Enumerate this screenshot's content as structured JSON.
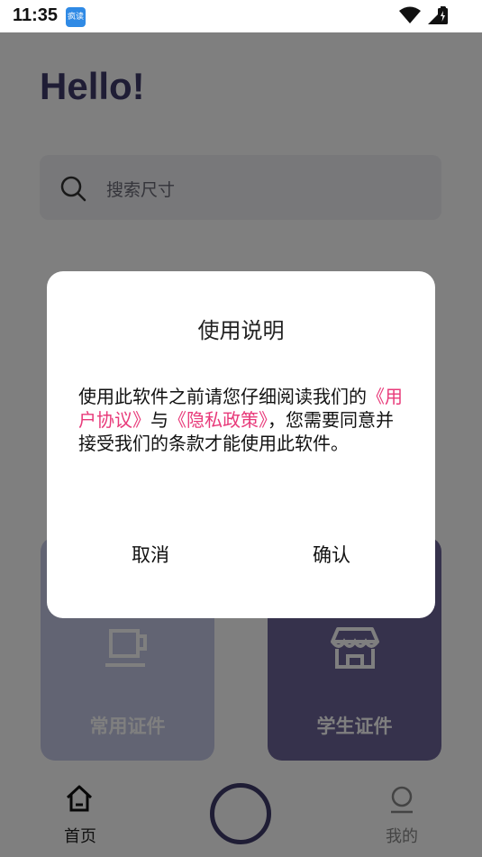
{
  "status_bar": {
    "time": "11:35",
    "app_icon_text": "疯读",
    "icons": [
      "wifi-icon",
      "signal-icon",
      "battery-charging-icon"
    ]
  },
  "home": {
    "greeting": "Hello!",
    "search": {
      "placeholder": "搜索尺寸",
      "icon": "search-icon"
    },
    "cards": [
      {
        "label": "常用证件",
        "icon": "coffee-cup-icon",
        "color": "#c5c9e6"
      },
      {
        "label": "学生证件",
        "icon": "store-icon",
        "color": "#6c6498"
      }
    ]
  },
  "bottom_nav": {
    "home_label": "首页",
    "mine_label": "我的",
    "accent": "#3e3a6a"
  },
  "dialog": {
    "title": "使用说明",
    "body_part1": "使用此软件之前请您仔细阅读我们的",
    "link_user_agreement": "《用户协议》",
    "body_part2": "与",
    "link_privacy_policy": "《隐私政策》",
    "body_part3": "，您需要同意并接受我们的条款才能使用此软件。",
    "cancel_label": "取消",
    "confirm_label": "确认",
    "link_color": "#e83a7a"
  }
}
